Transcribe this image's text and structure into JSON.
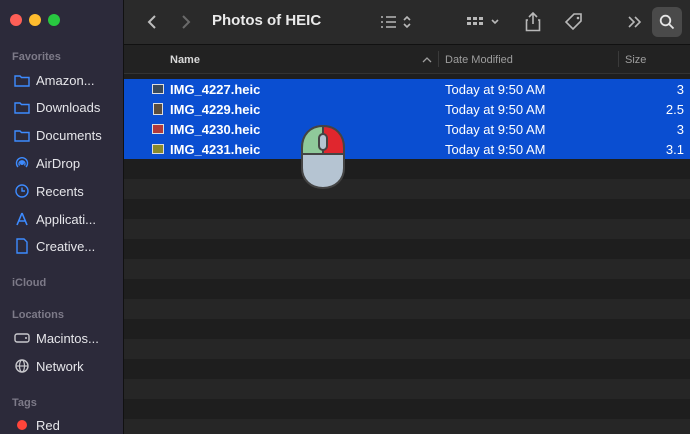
{
  "window": {
    "title": "Photos of HEIC",
    "accent": "#0a4ed1"
  },
  "sidebar": {
    "sections": {
      "favorites": "Favorites",
      "icloud": "iCloud",
      "locations": "Locations",
      "tags": "Tags"
    },
    "favorites": [
      {
        "label": "Amazon...",
        "icon": "folder-icon"
      },
      {
        "label": "Downloads",
        "icon": "folder-icon"
      },
      {
        "label": "Documents",
        "icon": "folder-icon"
      },
      {
        "label": "AirDrop",
        "icon": "airdrop-icon"
      },
      {
        "label": "Recents",
        "icon": "clock-icon"
      },
      {
        "label": "Applicati...",
        "icon": "applications-icon"
      },
      {
        "label": "Creative...",
        "icon": "document-icon"
      }
    ],
    "locations": [
      {
        "label": "Macintos...",
        "icon": "disk-icon"
      },
      {
        "label": "Network",
        "icon": "network-icon"
      }
    ],
    "tags": [
      {
        "label": "Red",
        "color": "#ff453a"
      }
    ]
  },
  "columns": {
    "name": "Name",
    "date_modified": "Date Modified",
    "size": "Size"
  },
  "files": [
    {
      "name": "IMG_4227.heic",
      "date": "Today at 9:50 AM",
      "size": "3",
      "selected": true
    },
    {
      "name": "IMG_4229.heic",
      "date": "Today at 9:50 AM",
      "size": "2.5",
      "selected": true
    },
    {
      "name": "IMG_4230.heic",
      "date": "Today at 9:50 AM",
      "size": "3",
      "selected": true
    },
    {
      "name": "IMG_4231.heic",
      "date": "Today at 9:50 AM",
      "size": "3.1",
      "selected": true
    }
  ]
}
